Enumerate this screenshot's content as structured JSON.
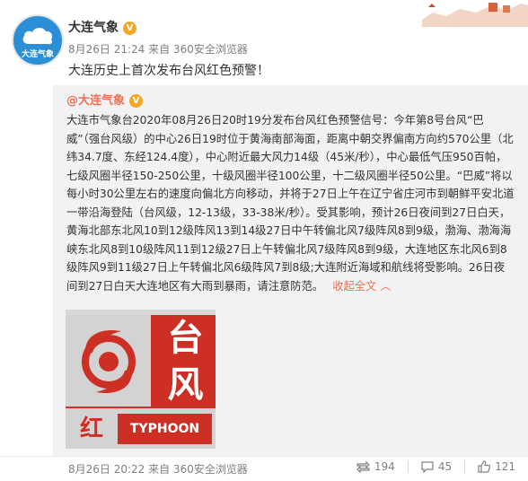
{
  "header": {
    "account_name": "大连气象",
    "verified_badge": "V",
    "avatar_text": "大连气象",
    "meta": "8月26日 21:24 来自 360安全浏览器",
    "headline": "大连历史上首次发布台风红色预警！"
  },
  "repost": {
    "author": "@大连气象",
    "verified_badge": "V",
    "body": "大连市气象台2020年08月26日20时19分发布台风红色预警信号：今年第8号台风“巴威”（强台风级）的中心26日19时位于黄海南部海面，距离中朝交界偏南方向约570公里（北纬34.7度、东经124.4度），中心附近最大风力14级（45米/秒），中心最低气压950百帕，七级风圈半径150-250公里，十级风圈半径100公里，十二级风圈半径50公里。“巴威”将以每小时30公里左右的速度向偏北方向移动，并将于27日上午在辽宁省庄河市到朝鲜平安北道一带沿海登陆（台风级，12-13级，33-38米/秒）。受其影响，预计26日夜间到27日白天，黄海北部东北风10到12级阵风13到14级27日中午转偏北风7级阵风8到9级，渤海、渤海海峡东北风8到10级阵风11到12级27日上午转偏北风7级阵风8到9级，大连地区东北风6到8级阵风9到11级27日上午转偏北风6级阵风7到8级;大连附近海域和航线将受影响。26日夜间到27日白天大连地区有大雨到暴雨，请注意防范。",
    "collapse_label": "收起全文",
    "collapse_icon": "chevron-up-icon",
    "image": {
      "char_tai": "台",
      "char_feng": "风",
      "char_hong": "红",
      "typhoon_word": "TYPHOON"
    }
  },
  "footer": {
    "meta": "8月26日 20:22 来自 360安全浏览器",
    "repost_count": "194",
    "comment_count": "45",
    "like_count": "121"
  },
  "colors": {
    "accent": "#eb7350",
    "repost_bg": "#f2f2f5",
    "signal_red": "#ce2f24",
    "avatar_blue": "#2a8fd6",
    "verified_gold": "#f5a623"
  }
}
